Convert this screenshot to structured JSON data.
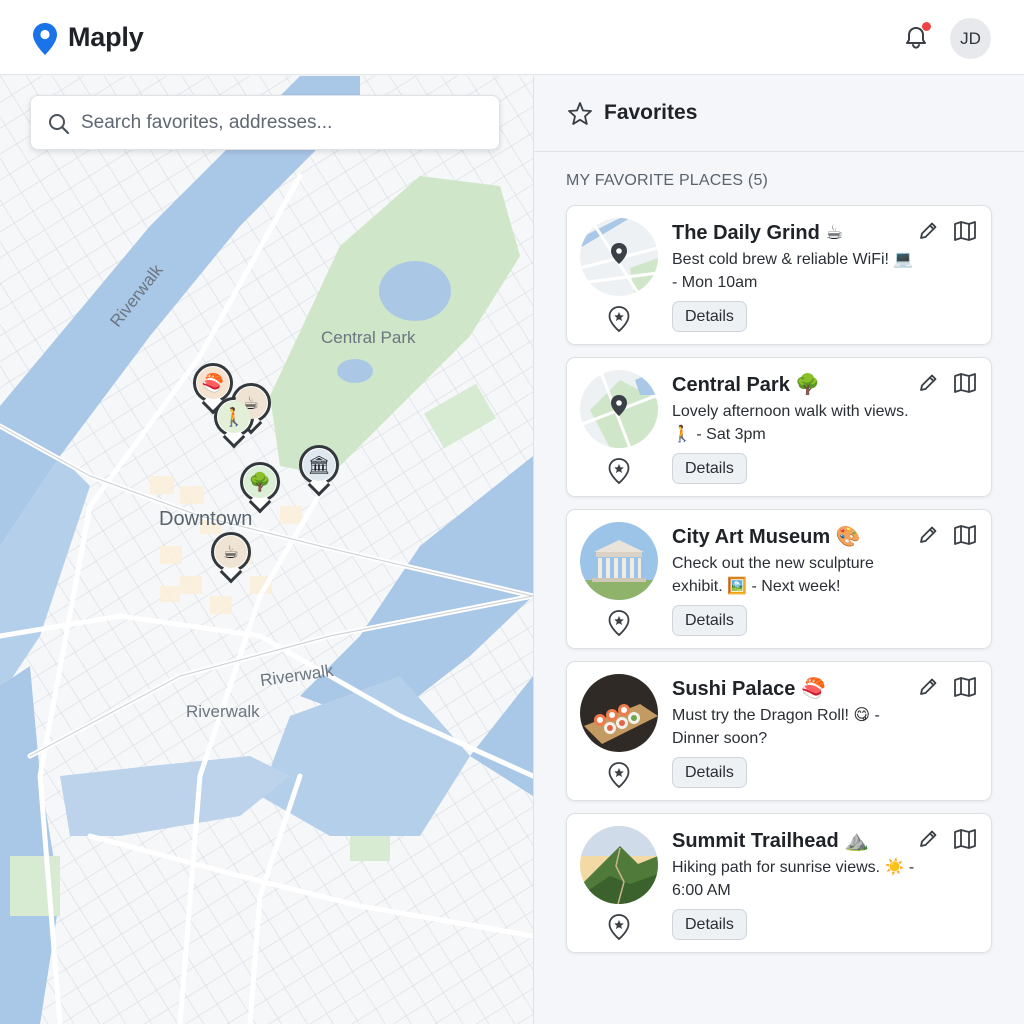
{
  "app": {
    "name": "Maply"
  },
  "header": {
    "avatar_initials": "JD",
    "notification_dot_color": "#ef4444"
  },
  "search": {
    "placeholder": "Search favorites, addresses..."
  },
  "map": {
    "labels": {
      "riverwalk_1": "Riverwalk",
      "central_park": "Central Park",
      "downtown": "Downtown",
      "riverwalk_2": "Riverwalk",
      "riverwalk_3": "Riverwalk"
    },
    "pins": [
      "sushi-icon",
      "coffee-icon",
      "hiker-icon",
      "tree-icon",
      "museum-icon",
      "coffee-icon"
    ]
  },
  "panel": {
    "title": "Favorites",
    "section_label": "MY FAVORITE PLACES (5)",
    "details_label": "Details",
    "places": [
      {
        "title": "The Daily Grind ☕",
        "note": "Best cold brew & reliable WiFi! 💻 - Mon 10am"
      },
      {
        "title": "Central Park 🌳",
        "note": "Lovely afternoon walk with views. 🚶 - Sat 3pm"
      },
      {
        "title": "City Art Museum 🎨",
        "note": "Check out the new sculpture exhibit. 🖼️ - Next week!"
      },
      {
        "title": "Sushi Palace 🍣",
        "note": "Must try the Dragon Roll! 😋 - Dinner soon?"
      },
      {
        "title": "Summit Trailhead ⛰️",
        "note": "Hiking path for sunrise views. ☀️ - 6:00 AM"
      }
    ]
  },
  "colors": {
    "brand_pin": "#1a73e8",
    "park_green": "#cfe6c9",
    "water_blue": "#a9c7e6"
  }
}
